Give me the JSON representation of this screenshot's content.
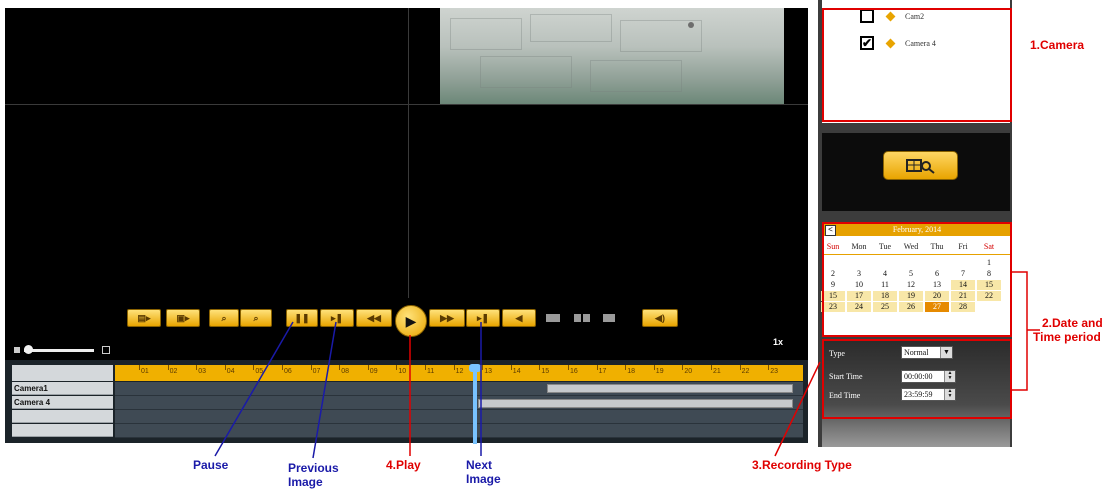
{
  "player": {
    "speed": "1x",
    "tracks": [
      {
        "label": "Camera1"
      },
      {
        "label": "Camera 4"
      },
      {
        "label": ""
      },
      {
        "label": ""
      }
    ],
    "hours": [
      "01",
      "02",
      "03",
      "04",
      "05",
      "06",
      "07",
      "08",
      "09",
      "10",
      "11",
      "12",
      "13",
      "14",
      "15",
      "16",
      "17",
      "18",
      "19",
      "20",
      "21",
      "22",
      "23"
    ]
  },
  "camera_list": {
    "items": [
      {
        "name": "Cam2",
        "checked": false
      },
      {
        "name": "Camera 4",
        "checked": true
      }
    ]
  },
  "calendar": {
    "prev": "<",
    "month_title": "February, 2014",
    "day_names": [
      "Sun",
      "Mon",
      "Tue",
      "Wed",
      "Thu",
      "Fri",
      "Sat"
    ],
    "weeks": [
      [
        "",
        "",
        "",
        "",
        "",
        "",
        "1"
      ],
      [
        "2",
        "3",
        "4",
        "5",
        "6",
        "7",
        "8"
      ],
      [
        "9",
        "10",
        "11",
        "12",
        "13",
        "14",
        "15"
      ],
      [
        "15",
        "17",
        "18",
        "19",
        "20",
        "21",
        "22"
      ],
      [
        "23",
        "24",
        "25",
        "26",
        "27",
        "28",
        ""
      ]
    ],
    "selected": "27"
  },
  "filters": {
    "type_label": "Type",
    "type_value": "Normal",
    "start_label": "Start Time",
    "start_value": "00:00:00",
    "end_label": "End Time",
    "end_value": "23:59:59"
  },
  "annotations": {
    "camera": "1.Camera",
    "date_line1": "2.Date and",
    "date_line2": "Time period",
    "recording_type": "3.Recording Type",
    "play": "4.Play",
    "pause": "Pause",
    "previous_line1": "Previous",
    "previous_line2": "Image",
    "next_line1": "Next",
    "next_line2": "Image"
  },
  "colors": {
    "accent": "#e8a400",
    "annotation_red": "#e00000",
    "annotation_blue": "#1a1aa8",
    "playhead": "#79c3ff"
  },
  "icons": [
    "pause-icon",
    "previous-image-icon",
    "rewind-icon",
    "play-icon",
    "fast-forward-icon",
    "next-image-icon",
    "volume-icon",
    "search-icon",
    "zoom-in-icon",
    "zoom-out-icon",
    "layout-icon",
    "snapshot-icon"
  ]
}
